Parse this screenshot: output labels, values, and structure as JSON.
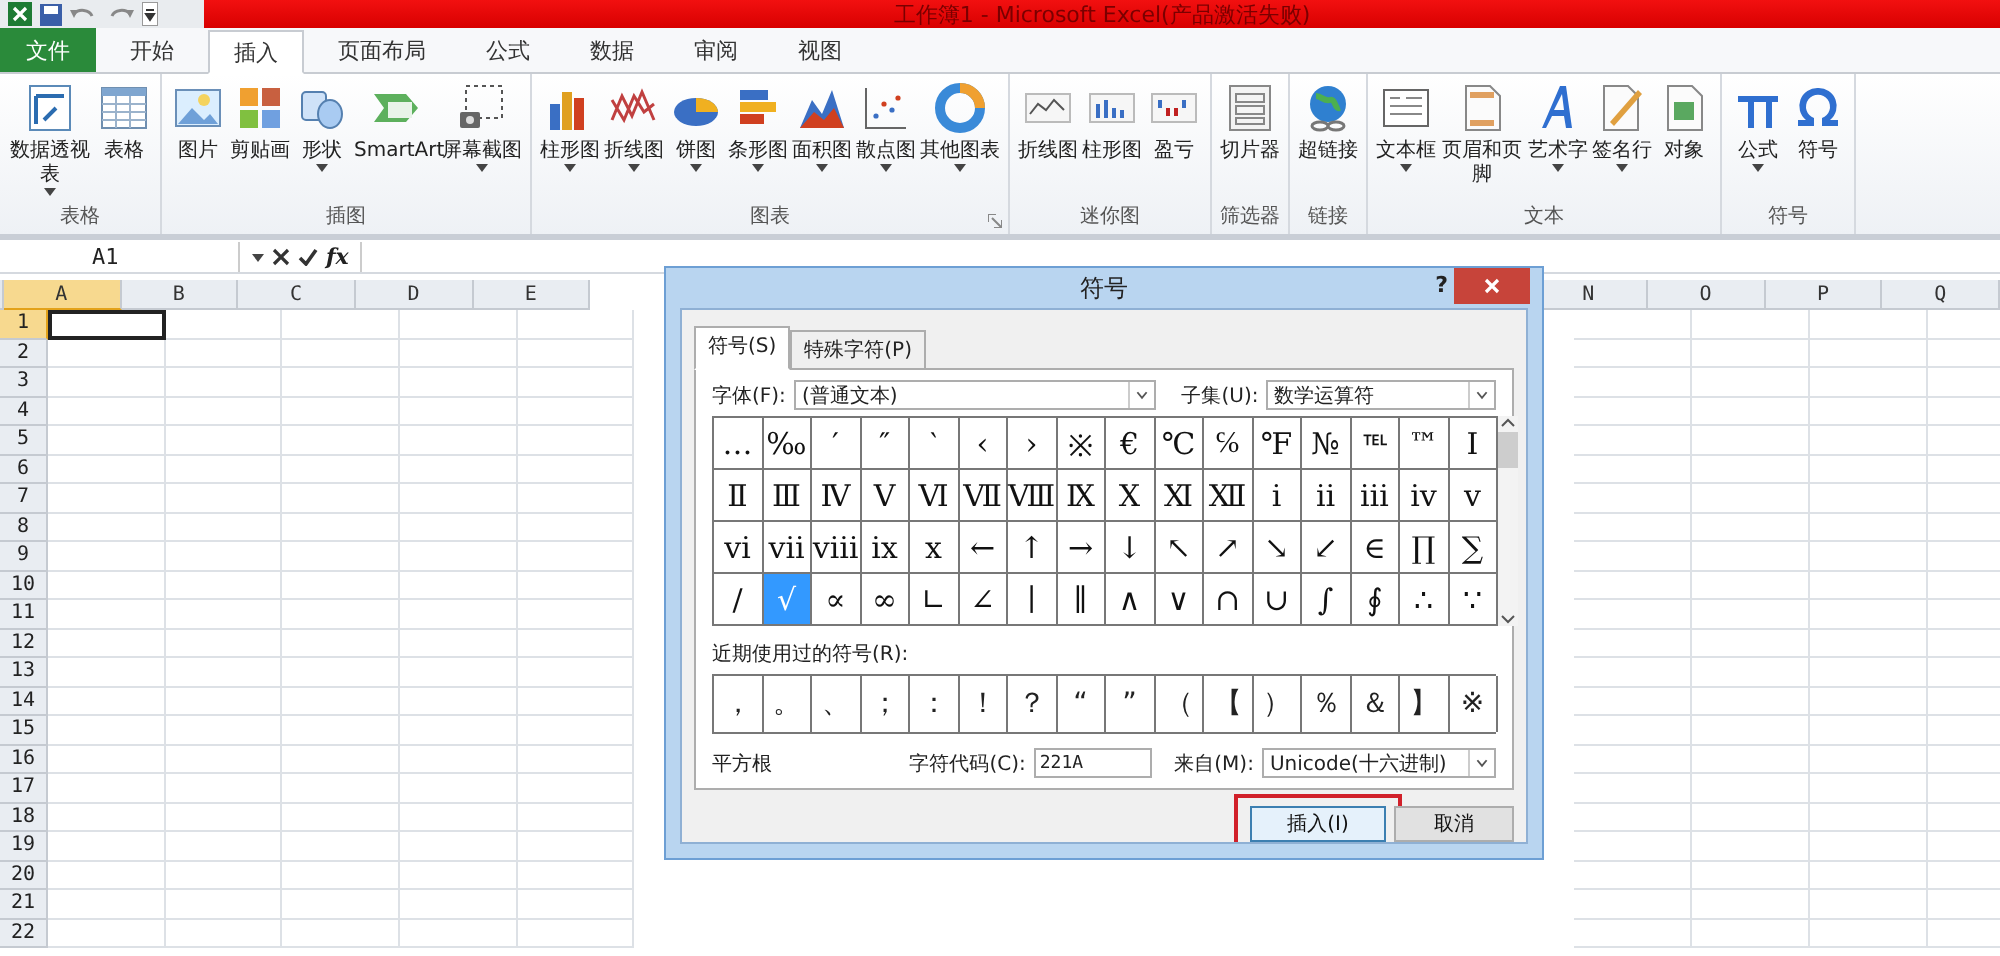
{
  "window": {
    "title": "工作簿1 - Microsoft Excel(产品激活失败)"
  },
  "ribbon_tabs": [
    {
      "label": "文件",
      "kind": "file",
      "selected": false
    },
    {
      "label": "开始",
      "kind": "tab",
      "selected": false
    },
    {
      "label": "插入",
      "kind": "tab",
      "selected": true
    },
    {
      "label": "页面布局",
      "kind": "tab",
      "selected": false
    },
    {
      "label": "公式",
      "kind": "tab",
      "selected": false
    },
    {
      "label": "数据",
      "kind": "tab",
      "selected": false
    },
    {
      "label": "审阅",
      "kind": "tab",
      "selected": false
    },
    {
      "label": "视图",
      "kind": "tab",
      "selected": false
    }
  ],
  "ribbon_groups": [
    {
      "label": "表格",
      "launcher": false,
      "buttons": [
        {
          "label": "数据透视表",
          "has_menu": true
        },
        {
          "label": "表格",
          "has_menu": false
        }
      ]
    },
    {
      "label": "插图",
      "launcher": false,
      "buttons": [
        {
          "label": "图片",
          "has_menu": false
        },
        {
          "label": "剪贴画",
          "has_menu": false
        },
        {
          "label": "形状",
          "has_menu": true
        },
        {
          "label": "SmartArt",
          "has_menu": false
        },
        {
          "label": "屏幕截图",
          "has_menu": true
        }
      ]
    },
    {
      "label": "图表",
      "launcher": true,
      "buttons": [
        {
          "label": "柱形图",
          "has_menu": true
        },
        {
          "label": "折线图",
          "has_menu": true
        },
        {
          "label": "饼图",
          "has_menu": true
        },
        {
          "label": "条形图",
          "has_menu": true
        },
        {
          "label": "面积图",
          "has_menu": true
        },
        {
          "label": "散点图",
          "has_menu": true
        },
        {
          "label": "其他图表",
          "has_menu": true
        }
      ]
    },
    {
      "label": "迷你图",
      "launcher": false,
      "buttons": [
        {
          "label": "折线图",
          "has_menu": false
        },
        {
          "label": "柱形图",
          "has_menu": false
        },
        {
          "label": "盈亏",
          "has_menu": false
        }
      ]
    },
    {
      "label": "筛选器",
      "launcher": false,
      "buttons": [
        {
          "label": "切片器",
          "has_menu": false
        }
      ]
    },
    {
      "label": "链接",
      "launcher": false,
      "buttons": [
        {
          "label": "超链接",
          "has_menu": false
        }
      ]
    },
    {
      "label": "文本",
      "launcher": false,
      "buttons": [
        {
          "label": "文本框",
          "has_menu": true
        },
        {
          "label": "页眉和页脚",
          "has_menu": false
        },
        {
          "label": "艺术字",
          "has_menu": true
        },
        {
          "label": "签名行",
          "has_menu": true
        },
        {
          "label": "对象",
          "has_menu": false
        }
      ]
    },
    {
      "label": "符号",
      "launcher": false,
      "buttons": [
        {
          "label": "公式",
          "has_menu": true
        },
        {
          "label": "符号",
          "has_menu": false
        }
      ]
    }
  ],
  "formula_bar": {
    "name_box": "A1",
    "function_label": "fx"
  },
  "sheet": {
    "columns_left": [
      {
        "label": "A",
        "selected": true
      },
      {
        "label": "B",
        "selected": false
      },
      {
        "label": "C",
        "selected": false
      },
      {
        "label": "D",
        "selected": false
      },
      {
        "label": "E",
        "selected": false
      }
    ],
    "columns_right": [
      {
        "label": "N",
        "selected": false
      },
      {
        "label": "O",
        "selected": false
      },
      {
        "label": "P",
        "selected": false
      },
      {
        "label": "Q",
        "selected": false
      }
    ],
    "rows": [
      {
        "label": "1",
        "selected": true
      },
      {
        "label": "2",
        "selected": false
      },
      {
        "label": "3",
        "selected": false
      },
      {
        "label": "4",
        "selected": false
      },
      {
        "label": "5",
        "selected": false
      },
      {
        "label": "6",
        "selected": false
      },
      {
        "label": "7",
        "selected": false
      },
      {
        "label": "8",
        "selected": false
      },
      {
        "label": "9",
        "selected": false
      },
      {
        "label": "10",
        "selected": false
      },
      {
        "label": "11",
        "selected": false
      },
      {
        "label": "12",
        "selected": false
      },
      {
        "label": "13",
        "selected": false
      },
      {
        "label": "14",
        "selected": false
      },
      {
        "label": "15",
        "selected": false
      },
      {
        "label": "16",
        "selected": false
      },
      {
        "label": "17",
        "selected": false
      },
      {
        "label": "18",
        "selected": false
      },
      {
        "label": "19",
        "selected": false
      },
      {
        "label": "20",
        "selected": false
      },
      {
        "label": "21",
        "selected": false
      },
      {
        "label": "22",
        "selected": false
      }
    ]
  },
  "dialog": {
    "title": "符号",
    "help": "?",
    "tabs": [
      {
        "label": "符号(S)",
        "selected": true
      },
      {
        "label": "特殊字符(P)",
        "selected": false
      }
    ],
    "font_label": "字体(F):",
    "font_value": "(普通文本)",
    "subset_label": "子集(U):",
    "subset_value": "数学运算符",
    "symbols": [
      {
        "char": "…",
        "selected": false
      },
      {
        "char": "‰",
        "selected": false
      },
      {
        "char": "′",
        "selected": false
      },
      {
        "char": "″",
        "selected": false
      },
      {
        "char": "‵",
        "selected": false
      },
      {
        "char": "‹",
        "selected": false
      },
      {
        "char": "›",
        "selected": false
      },
      {
        "char": "※",
        "selected": false
      },
      {
        "char": "€",
        "selected": false
      },
      {
        "char": "℃",
        "selected": false
      },
      {
        "char": "℅",
        "selected": false
      },
      {
        "char": "℉",
        "selected": false
      },
      {
        "char": "№",
        "selected": false
      },
      {
        "char": "℡",
        "selected": false
      },
      {
        "char": "™",
        "selected": false
      },
      {
        "char": "Ⅰ",
        "selected": false
      },
      {
        "char": "Ⅱ",
        "selected": false
      },
      {
        "char": "Ⅲ",
        "selected": false
      },
      {
        "char": "Ⅳ",
        "selected": false
      },
      {
        "char": "Ⅴ",
        "selected": false
      },
      {
        "char": "Ⅵ",
        "selected": false
      },
      {
        "char": "Ⅶ",
        "selected": false
      },
      {
        "char": "Ⅷ",
        "selected": false
      },
      {
        "char": "Ⅸ",
        "selected": false
      },
      {
        "char": "Ⅹ",
        "selected": false
      },
      {
        "char": "Ⅺ",
        "selected": false
      },
      {
        "char": "Ⅻ",
        "selected": false
      },
      {
        "char": "ⅰ",
        "selected": false
      },
      {
        "char": "ⅱ",
        "selected": false
      },
      {
        "char": "ⅲ",
        "selected": false
      },
      {
        "char": "ⅳ",
        "selected": false
      },
      {
        "char": "ⅴ",
        "selected": false
      },
      {
        "char": "ⅵ",
        "selected": false
      },
      {
        "char": "ⅶ",
        "selected": false
      },
      {
        "char": "ⅷ",
        "selected": false
      },
      {
        "char": "ⅸ",
        "selected": false
      },
      {
        "char": "ⅹ",
        "selected": false
      },
      {
        "char": "←",
        "selected": false
      },
      {
        "char": "↑",
        "selected": false
      },
      {
        "char": "→",
        "selected": false
      },
      {
        "char": "↓",
        "selected": false
      },
      {
        "char": "↖",
        "selected": false
      },
      {
        "char": "↗",
        "selected": false
      },
      {
        "char": "↘",
        "selected": false
      },
      {
        "char": "↙",
        "selected": false
      },
      {
        "char": "∈",
        "selected": false
      },
      {
        "char": "∏",
        "selected": false
      },
      {
        "char": "∑",
        "selected": false
      },
      {
        "char": "∕",
        "selected": false
      },
      {
        "char": "√",
        "selected": true
      },
      {
        "char": "∝",
        "selected": false
      },
      {
        "char": "∞",
        "selected": false
      },
      {
        "char": "∟",
        "selected": false
      },
      {
        "char": "∠",
        "selected": false
      },
      {
        "char": "∣",
        "selected": false
      },
      {
        "char": "∥",
        "selected": false
      },
      {
        "char": "∧",
        "selected": false
      },
      {
        "char": "∨",
        "selected": false
      },
      {
        "char": "∩",
        "selected": false
      },
      {
        "char": "∪",
        "selected": false
      },
      {
        "char": "∫",
        "selected": false
      },
      {
        "char": "∮",
        "selected": false
      },
      {
        "char": "∴",
        "selected": false
      },
      {
        "char": "∵",
        "selected": false
      }
    ],
    "recent_label": "近期使用过的符号(R):",
    "recent": [
      "，",
      "。",
      "、",
      "；",
      "：",
      "！",
      "？",
      "“",
      "”",
      "（",
      "【",
      "）",
      "％",
      "＆",
      "】",
      "※"
    ],
    "symbol_name": "平方根",
    "code_label": "字符代码(C):",
    "code_value": "221A",
    "from_label": "来自(M):",
    "from_value": "Unicode(十六进制)",
    "buttons": [
      {
        "label": "插入(I)",
        "kind": "primary",
        "highlighted": true
      },
      {
        "label": "取消",
        "kind": "normal",
        "highlighted": false
      }
    ]
  }
}
